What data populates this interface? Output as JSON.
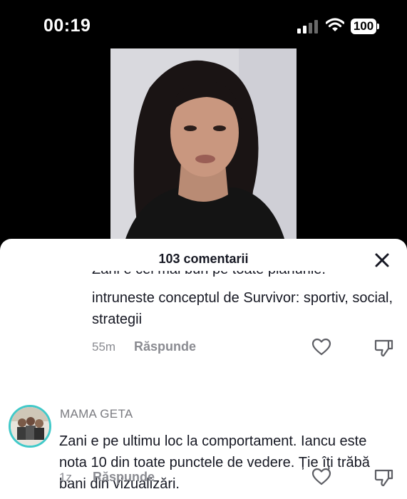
{
  "status_bar": {
    "time": "00:19",
    "battery": "100",
    "signal_icon": "cellular-signal-icon",
    "wifi_icon": "wifi-icon"
  },
  "sheet": {
    "title": "103 comentarii",
    "close_icon": "close-icon"
  },
  "comments": [
    {
      "clipped_line": "Zani e cel mai bun pe toate planurile.",
      "text": "intruneste conceptul de Survivor: sportiv, social, strategii",
      "time": "55m",
      "reply_label": "Răspunde"
    },
    {
      "username": "MAMA GETA",
      "text": "Zani e pe ultimu loc la comportament. Iancu este nota 10 din toate punctele de vedere. Ție îți trăbă bani din vizualizări.",
      "time": "1z",
      "reply_label": "Răspunde"
    }
  ],
  "colors": {
    "accent_ring": "#41c9c9",
    "text_primary": "#161823",
    "text_secondary": "#8a8b91"
  }
}
